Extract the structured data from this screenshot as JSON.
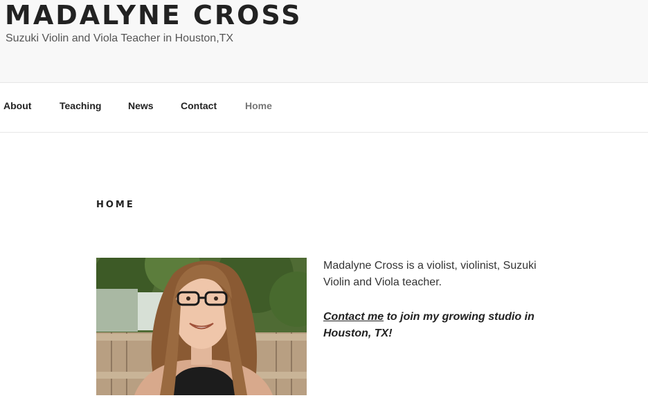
{
  "header": {
    "site_title": "MADALYNE CROSS",
    "site_description": "Suzuki Violin and Viola Teacher in Houston,TX"
  },
  "nav": {
    "items": [
      {
        "label": "About"
      },
      {
        "label": "Teaching"
      },
      {
        "label": "News"
      },
      {
        "label": "Contact"
      },
      {
        "label": "Home"
      }
    ]
  },
  "main": {
    "page_heading": "HOME",
    "intro_text": "Madalyne Cross is a violist, violinist, Suzuki Violin and Viola teacher.",
    "cta_link_text": "Contact me",
    "cta_rest_text": " to join my growing studio in Houston, TX!"
  },
  "colors": {
    "header_bg": "#f8f8f8",
    "text": "#222222",
    "nav_current": "#767676"
  }
}
